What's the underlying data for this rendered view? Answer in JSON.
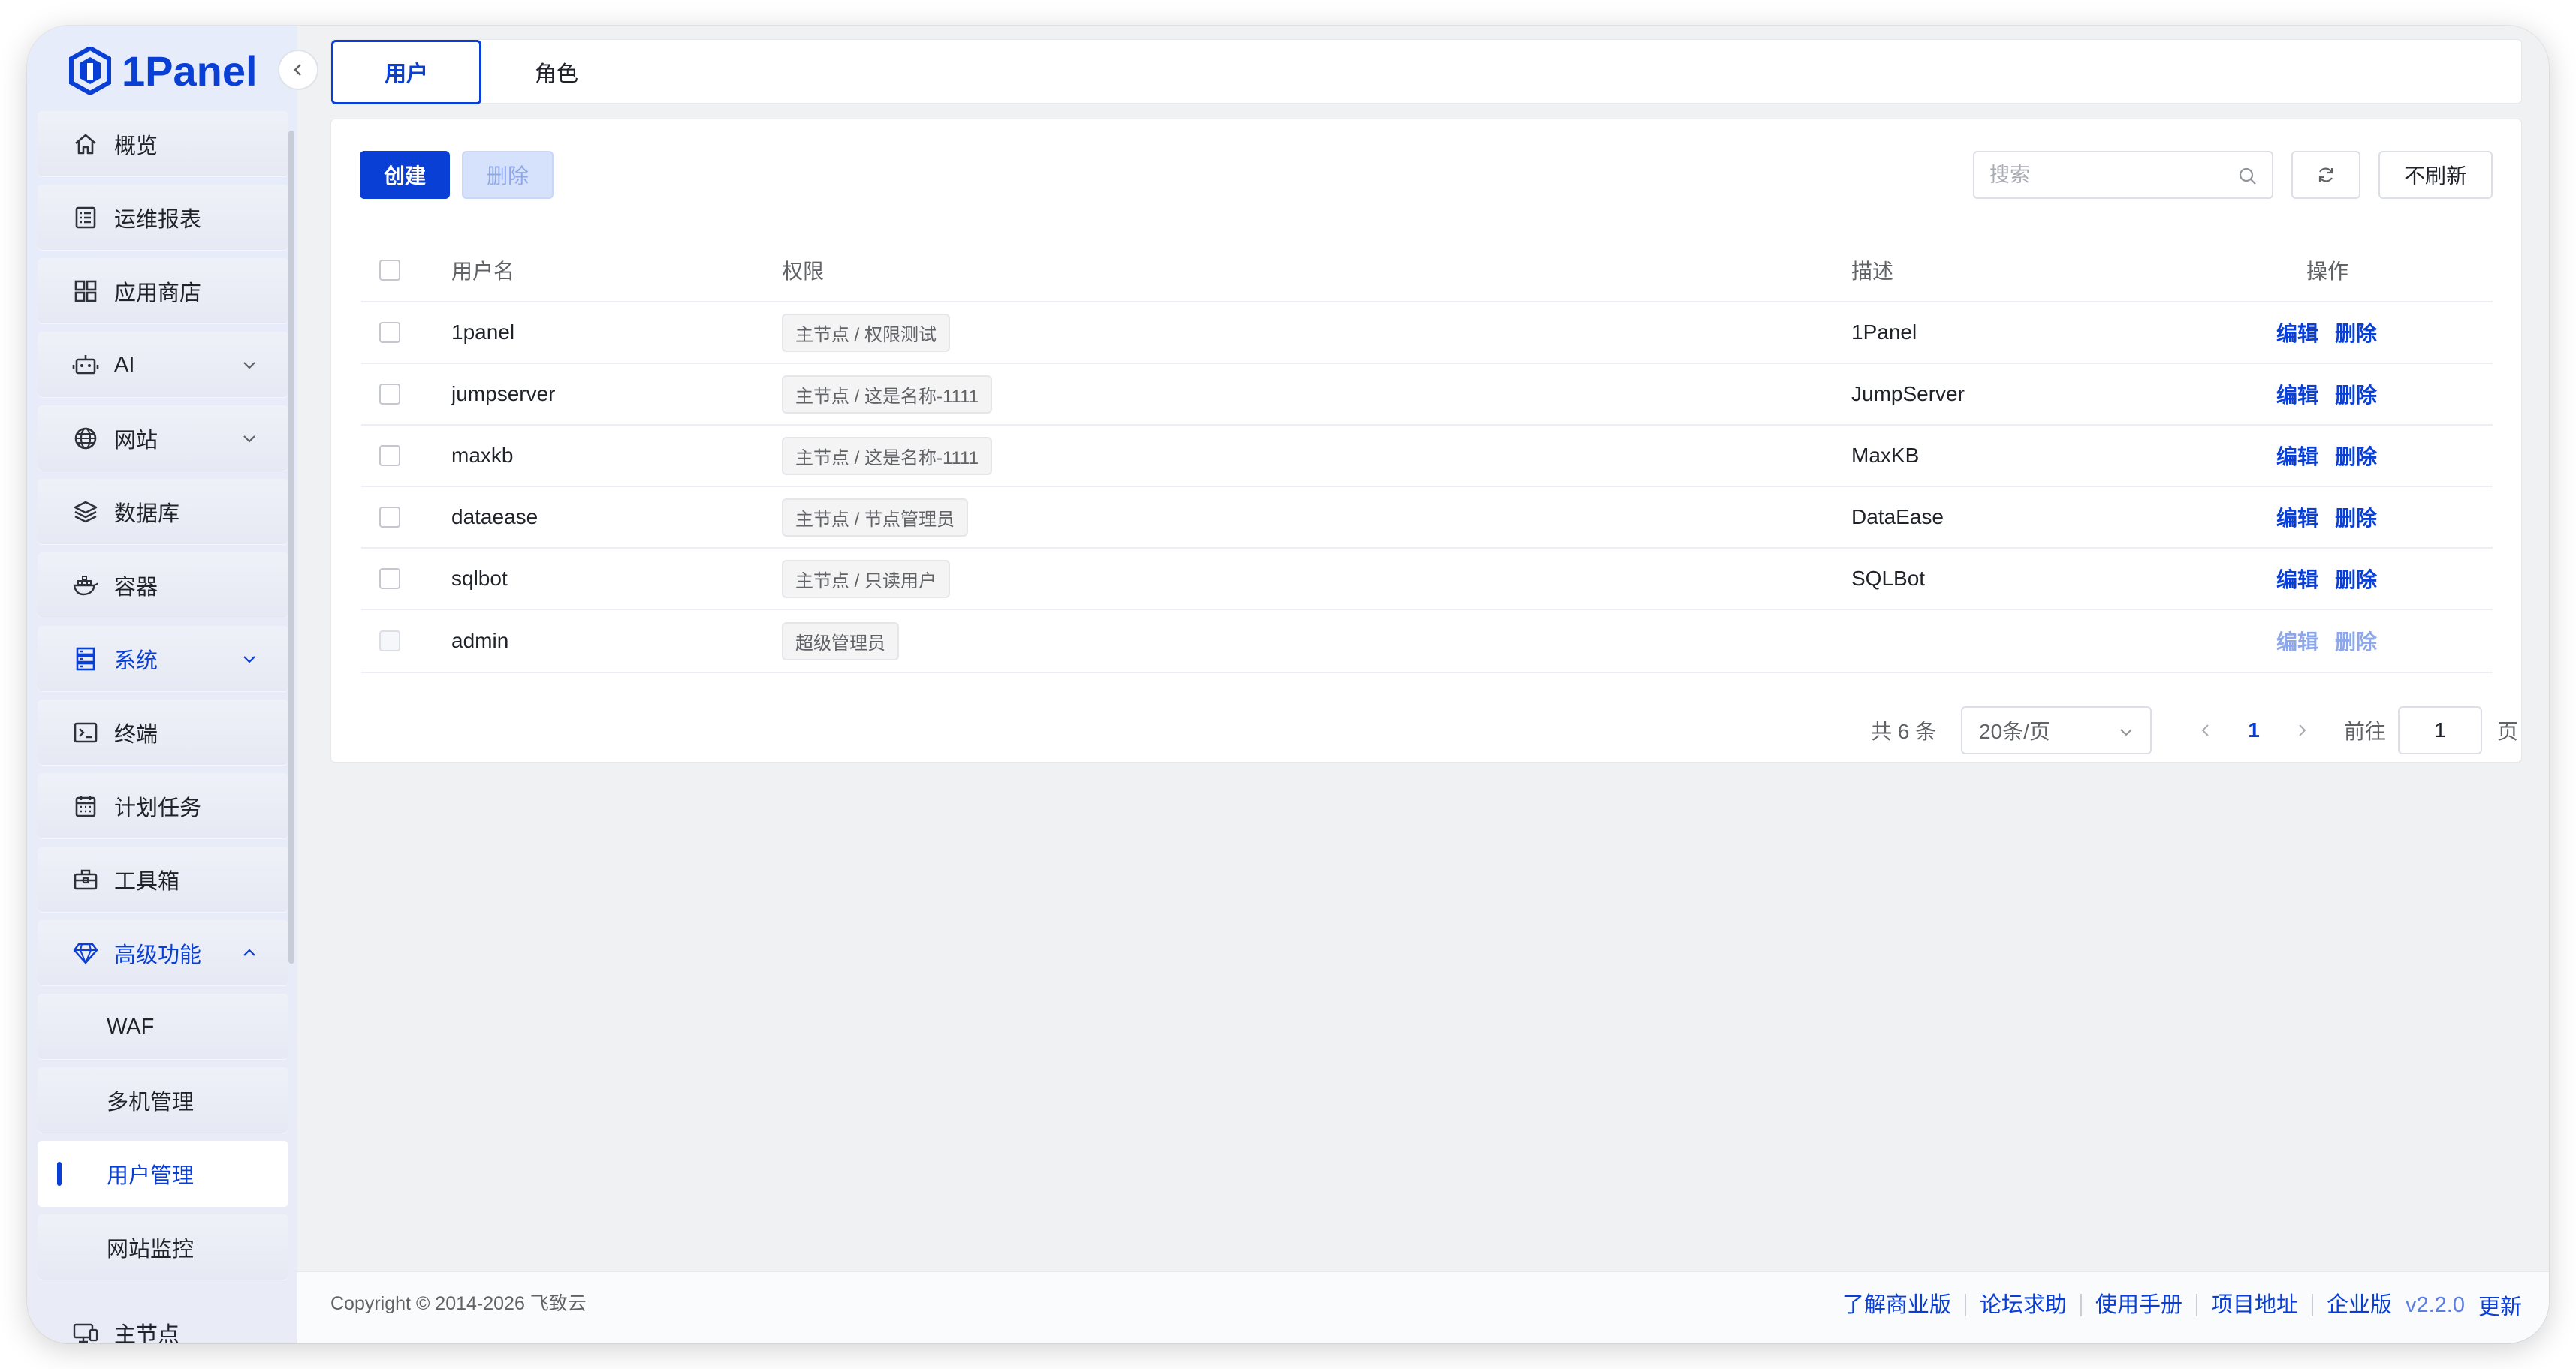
{
  "app": {
    "logo_text": "1Panel"
  },
  "sidebar": {
    "items": [
      {
        "label": "概览",
        "icon": "home-icon"
      },
      {
        "label": "运维报表",
        "icon": "report-icon"
      },
      {
        "label": "应用商店",
        "icon": "apps-grid-icon"
      },
      {
        "label": "AI",
        "icon": "robot-icon",
        "expandable": true
      },
      {
        "label": "网站",
        "icon": "globe-icon",
        "expandable": true
      },
      {
        "label": "数据库",
        "icon": "layers-icon"
      },
      {
        "label": "容器",
        "icon": "docker-icon"
      },
      {
        "label": "系统",
        "icon": "server-icon",
        "expandable": true
      },
      {
        "label": "终端",
        "icon": "terminal-icon"
      },
      {
        "label": "计划任务",
        "icon": "calendar-icon"
      },
      {
        "label": "工具箱",
        "icon": "toolbox-icon"
      },
      {
        "label": "高级功能",
        "icon": "diamond-icon",
        "expanded": true
      },
      {
        "label": "WAF"
      },
      {
        "label": "多机管理"
      },
      {
        "label": "用户管理",
        "active": true
      },
      {
        "label": "网站监控"
      }
    ],
    "node_label": "主节点"
  },
  "tabs": [
    {
      "label": "用户",
      "active": true
    },
    {
      "label": "角色"
    }
  ],
  "toolbar": {
    "create_label": "创建",
    "delete_label": "删除",
    "search_placeholder": "搜索",
    "no_refresh_label": "不刷新"
  },
  "table": {
    "headers": {
      "username": "用户名",
      "permission": "权限",
      "description": "描述",
      "actions": "操作"
    },
    "rows": [
      {
        "username": "1panel",
        "permission": "主节点 / 权限测试",
        "description": "1Panel",
        "edit": "编辑",
        "delete": "删除"
      },
      {
        "username": "jumpserver",
        "permission": "主节点 / 这是名称-1111",
        "description": "JumpServer",
        "edit": "编辑",
        "delete": "删除"
      },
      {
        "username": "maxkb",
        "permission": "主节点 / 这是名称-1111",
        "description": "MaxKB",
        "edit": "编辑",
        "delete": "删除"
      },
      {
        "username": "dataease",
        "permission": "主节点 / 节点管理员",
        "description": "DataEase",
        "edit": "编辑",
        "delete": "删除"
      },
      {
        "username": "sqlbot",
        "permission": "主节点 / 只读用户",
        "description": "SQLBot",
        "edit": "编辑",
        "delete": "删除"
      },
      {
        "username": "admin",
        "permission": "超级管理员",
        "description": "",
        "edit": "编辑",
        "delete": "删除",
        "disabled": true
      }
    ]
  },
  "pagination": {
    "total_text": "共 6 条",
    "page_size": "20条/页",
    "current_page": "1",
    "goto_label": "前往",
    "goto_value": "1",
    "page_unit": "页"
  },
  "footer": {
    "copyright": "Copyright © 2014-2026 飞致云",
    "links": [
      "了解商业版",
      "论坛求助",
      "使用手册",
      "项目地址",
      "企业版"
    ],
    "version": "v2.2.0",
    "update_label": "更新"
  },
  "colors": {
    "accent": "#0a3fd6",
    "background": "#f0f1f3",
    "sidebar": "#e9ecf6"
  }
}
